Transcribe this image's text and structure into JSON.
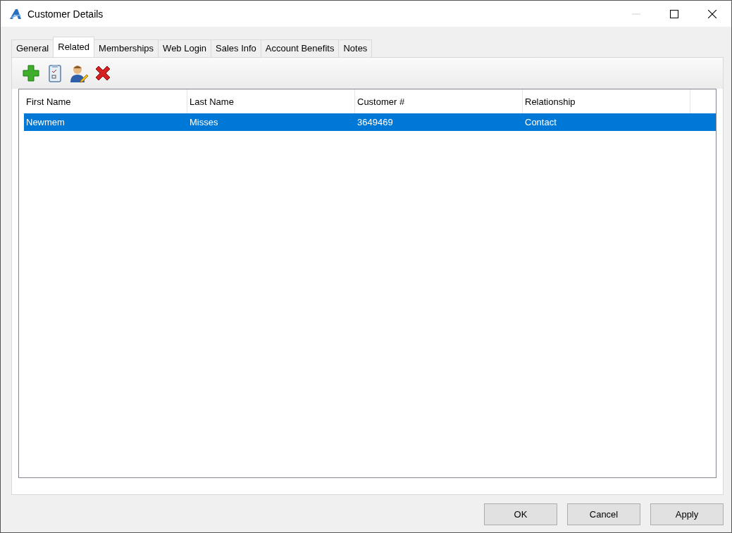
{
  "window": {
    "title": "Customer Details",
    "minimize_disabled": true
  },
  "tabs": [
    {
      "label": "General",
      "selected": false
    },
    {
      "label": "Related",
      "selected": true
    },
    {
      "label": "Memberships",
      "selected": false
    },
    {
      "label": "Web Login",
      "selected": false
    },
    {
      "label": "Sales Info",
      "selected": false
    },
    {
      "label": "Account Benefits",
      "selected": false
    },
    {
      "label": "Notes",
      "selected": false
    }
  ],
  "toolbar": [
    {
      "kind": "add"
    },
    {
      "kind": "clipboard"
    },
    {
      "kind": "edit-user"
    },
    {
      "kind": "delete"
    }
  ],
  "table": {
    "columns": [
      "First Name",
      "Last Name",
      "Customer #",
      "Relationship"
    ],
    "rows": [
      {
        "cells": [
          "Newmem",
          "Misses",
          "3649469",
          "Contact"
        ],
        "selected": true
      }
    ]
  },
  "buttons": [
    "OK",
    "Cancel",
    "Apply"
  ]
}
